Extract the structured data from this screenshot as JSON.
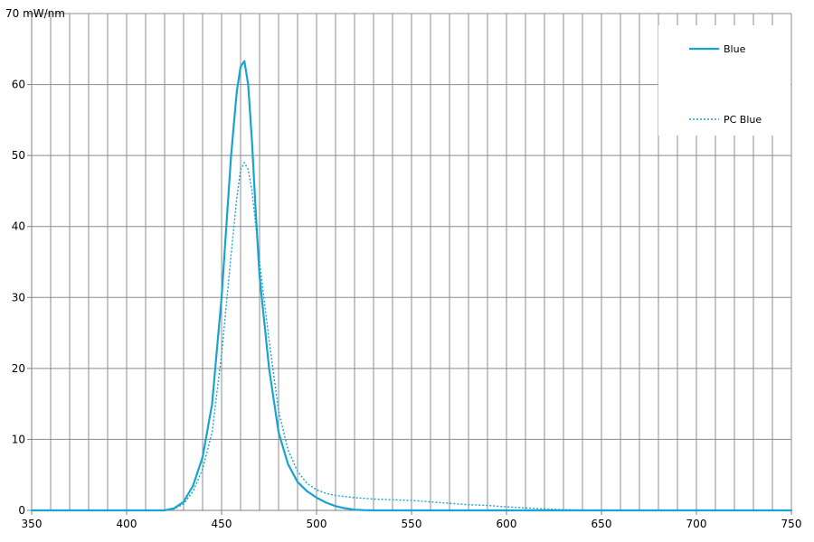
{
  "chart_data": {
    "type": "line",
    "title": "",
    "xlabel": "",
    "ylabel": "",
    "y_unit": "mW/nm",
    "xlim": [
      350,
      750
    ],
    "ylim": [
      0,
      70
    ],
    "x_ticks": [
      350,
      400,
      450,
      500,
      550,
      600,
      650,
      700,
      750
    ],
    "y_ticks": [
      0,
      10,
      20,
      30,
      40,
      50,
      60,
      70
    ],
    "y_top_label": "70 mW/nm",
    "grid": true,
    "minor_x_grid_step": 10,
    "legend": {
      "position": "top-right"
    },
    "series": [
      {
        "name": "Blue",
        "color": "#1aa3d1",
        "style": "solid",
        "x": [
          350,
          420,
          425,
          430,
          435,
          440,
          445,
          450,
          455,
          458,
          460,
          462,
          464,
          466,
          468,
          470,
          475,
          480,
          485,
          490,
          495,
          500,
          505,
          510,
          515,
          520,
          525,
          530,
          750
        ],
        "y": [
          0,
          0,
          0.3,
          1.2,
          3.5,
          7.5,
          15,
          30,
          50,
          59,
          62.5,
          63.3,
          60,
          52,
          42,
          33,
          20,
          11,
          6.5,
          4,
          2.7,
          1.8,
          1.1,
          0.6,
          0.3,
          0.1,
          0.03,
          0,
          0
        ]
      },
      {
        "name": "PC Blue",
        "color": "#1aa3d1",
        "style": "dotted",
        "x": [
          350,
          420,
          425,
          430,
          435,
          440,
          445,
          450,
          455,
          458,
          460,
          462,
          464,
          466,
          468,
          470,
          475,
          480,
          485,
          490,
          495,
          500,
          505,
          510,
          520,
          530,
          540,
          550,
          560,
          570,
          580,
          590,
          600,
          610,
          620,
          630,
          640,
          650,
          660,
          750
        ],
        "y": [
          0,
          0,
          0.2,
          0.9,
          2.7,
          5.8,
          11,
          22,
          36,
          44,
          48,
          49,
          48,
          45,
          40,
          35,
          24,
          14,
          8.5,
          5.5,
          3.8,
          2.9,
          2.4,
          2.1,
          1.8,
          1.6,
          1.5,
          1.4,
          1.2,
          1.0,
          0.8,
          0.7,
          0.5,
          0.35,
          0.2,
          0.1,
          0.05,
          0.02,
          0,
          0
        ]
      }
    ]
  }
}
